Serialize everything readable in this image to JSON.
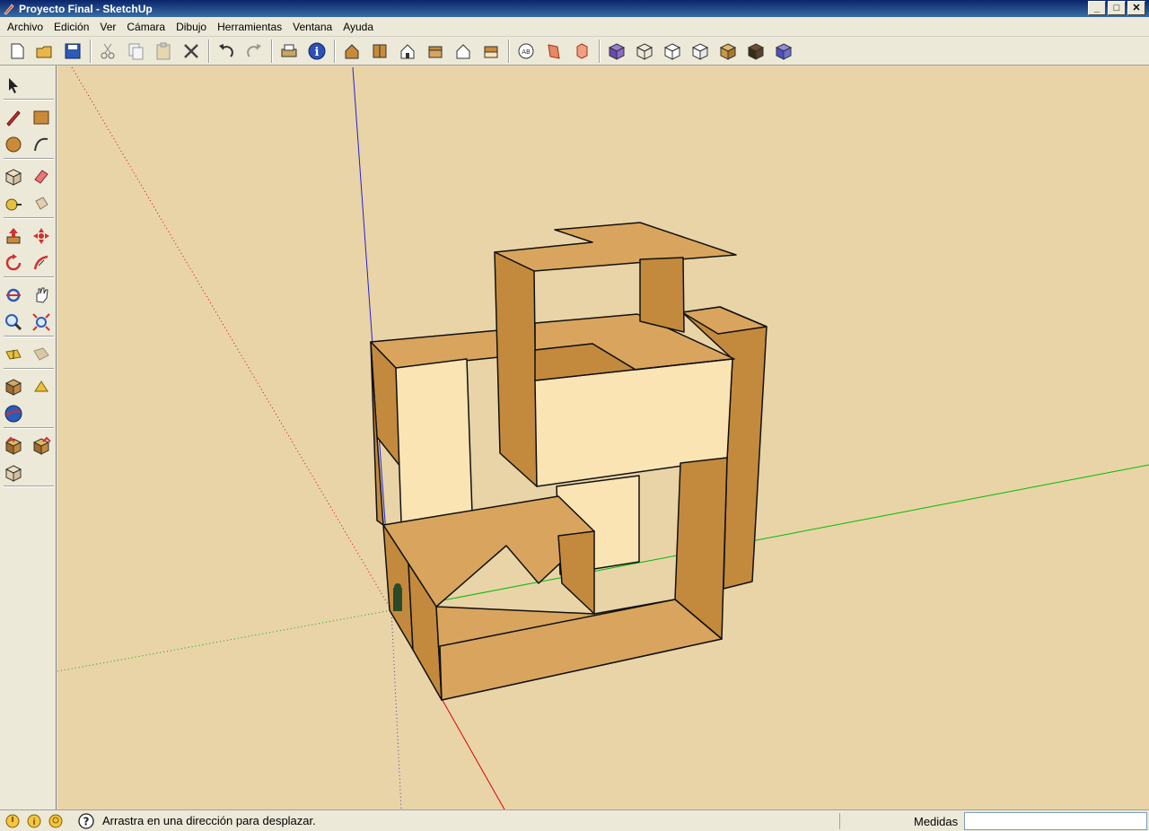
{
  "window": {
    "title": "Proyecto Final - SketchUp",
    "controls": [
      "minimize",
      "maximize",
      "close"
    ]
  },
  "menu": [
    "Archivo",
    "Edición",
    "Ver",
    "Cámara",
    "Dibujo",
    "Herramientas",
    "Ventana",
    "Ayuda"
  ],
  "toolbar": {
    "groups": [
      [
        "new-icon",
        "open-icon",
        "save-icon"
      ],
      [
        "cut-icon",
        "copy-icon",
        "paste-icon",
        "erase-icon"
      ],
      [
        "undo-icon",
        "redo-icon"
      ],
      [
        "print-icon",
        "model-info-icon"
      ],
      [
        "view-iso-icon",
        "view-top-icon",
        "view-front-icon",
        "view-right-icon",
        "view-back-icon",
        "view-left-icon"
      ],
      [
        "section-plane-icon",
        "display-section-planes-icon",
        "display-section-cuts-icon"
      ],
      [
        "xray-icon",
        "wireframe-icon",
        "hidden-line-icon",
        "shaded-icon",
        "shaded-textures-icon",
        "monochrome-icon",
        "extra-style-icon"
      ]
    ]
  },
  "left_toolbar": {
    "rows": [
      [
        "select-icon"
      ],
      [
        "pencil-icon",
        "rectangle-icon"
      ],
      [
        "circle-icon",
        "arc-icon"
      ],
      [
        "make-component-icon",
        "eraser-icon"
      ],
      [
        "tape-measure-icon",
        "paint-bucket-icon"
      ],
      [
        "push-pull-icon",
        "move-icon"
      ],
      [
        "rotate-icon",
        "follow-me-icon"
      ],
      [
        "orbit-icon",
        "pan-icon"
      ],
      [
        "zoom-icon",
        "zoom-extents-icon"
      ],
      [
        "add-location-icon",
        "toggle-terrain-icon"
      ],
      [
        "place-model-icon",
        "get-models-icon"
      ],
      [
        "google-earth-icon"
      ],
      [
        "share-model-icon",
        "upload-icon"
      ],
      [
        "share-component-icon"
      ]
    ]
  },
  "statusbar": {
    "icons": [
      "geo-location-icon",
      "credits-icon",
      "user-icon"
    ],
    "help_icon": "help-icon",
    "text": "Arrastra en una dirección para desplazar.",
    "measurements_label": "Medidas",
    "measurements_value": ""
  },
  "colors": {
    "viewport_background": "#e9d4a8",
    "model_front": "#fbe4b4",
    "model_top": "#d9a55e",
    "model_side": "#c38a3e",
    "axis_red": "#dd0000",
    "axis_green": "#00bb00",
    "axis_blue": "#2222cc",
    "titlebar": "#0a246a"
  }
}
